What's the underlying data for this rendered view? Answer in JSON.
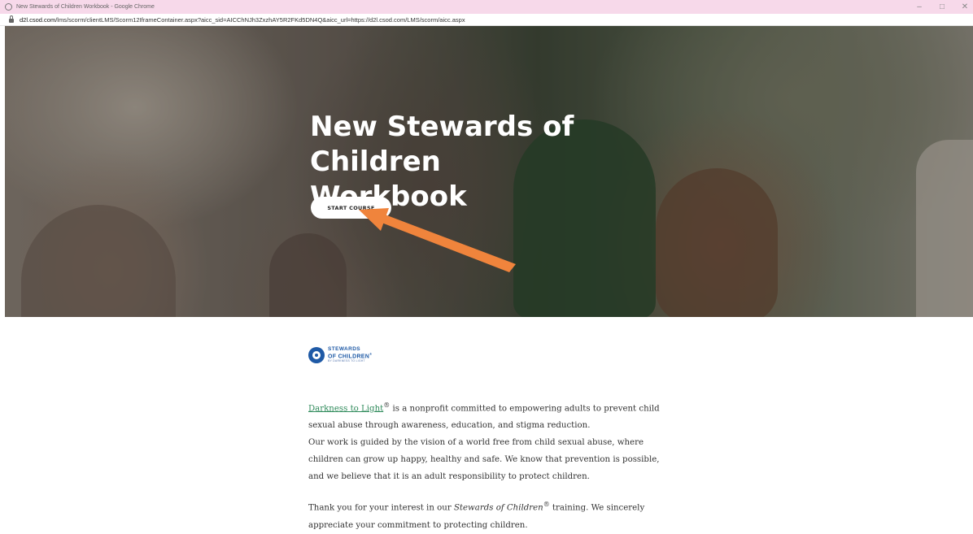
{
  "window": {
    "title": "New Stewards of Children Workbook - Google Chrome",
    "controls": [
      "–",
      "□",
      "✕"
    ]
  },
  "address_bar": {
    "url_host": "d2l.csod.com",
    "url_path": "/lms/scorm/clientLMS/Scorm12IframeContainer.aspx?aicc_sid=AICChNJh3ZxzhAY5R2FKd5DN4Q&aicc_url=https://d2l.csod.com/LMS/scorm/aicc.aspx"
  },
  "hero": {
    "title": "New Stewards of Children Workbook",
    "button_label": "START COURSE",
    "annotation_color": "#f0843c"
  },
  "logo": {
    "line1": "STEWARDS",
    "line2": "OF CHILDREN",
    "reg": "®",
    "line3": "BY DARKNESS TO LIGHT"
  },
  "content": {
    "link_text": "Darkness to Light",
    "reg": "®",
    "p1_rest": " is a nonprofit committed to empowering adults to prevent child sexual abuse through awareness, education, and stigma reduction.",
    "p2": "Our work is guided by the vision of a world free from child sexual abuse, where children can grow up happy, healthy and safe. We know that prevention is possible, and we believe that it is an adult responsibility to protect children.",
    "p3_start": "Thank you for your interest in our ",
    "p3_italic": "Stewards of Children",
    "p3_end": " training. We sincerely appreciate your commitment to protecting children."
  }
}
